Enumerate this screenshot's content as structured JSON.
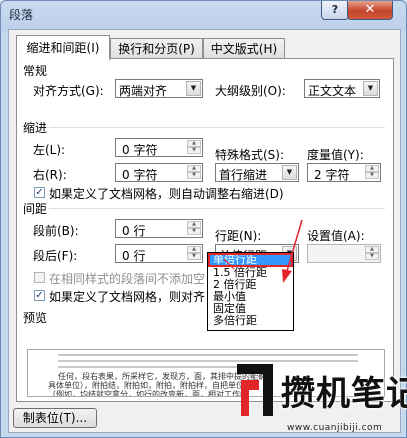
{
  "window": {
    "title": "段落",
    "help_label": "?",
    "close_label": "✕"
  },
  "tabs": [
    {
      "label": "缩进和间距(I)",
      "active": true
    },
    {
      "label": "换行和分页(P)",
      "active": false
    },
    {
      "label": "中文版式(H)",
      "active": false
    }
  ],
  "general": {
    "heading": "常规",
    "alignment_label": "对齐方式(G):",
    "alignment_value": "两端对齐",
    "outline_label": "大纲级别(O):",
    "outline_value": "正文文本"
  },
  "indent": {
    "heading": "缩进",
    "left_label": "左(L):",
    "left_value": "0 字符",
    "right_label": "右(R):",
    "right_value": "0 字符",
    "special_label": "特殊格式(S):",
    "special_value": "首行缩进",
    "measure_label": "度量值(Y):",
    "measure_value": "2 字符",
    "auto_adjust_label": "如果定义了文档网格，则自动调整右缩进(D)",
    "auto_adjust_checked": true
  },
  "spacing": {
    "heading": "间距",
    "before_label": "段前(B):",
    "before_value": "0 行",
    "after_label": "段后(F):",
    "after_value": "0 行",
    "line_spacing_label": "行距(N):",
    "line_spacing_value": "单倍行距",
    "setting_label": "设置值(A):",
    "setting_value": "",
    "no_space_label": "在相同样式的段落间不添加空",
    "no_space_checked": false,
    "snap_grid_label": "如果定义了文档网格，则对齐",
    "snap_grid_checked": true
  },
  "line_spacing_options": [
    "单倍行距",
    "1.5 倍行距",
    "2 倍行距",
    "最小值",
    "固定值",
    "多倍行距"
  ],
  "preview": {
    "heading": "预览",
    "sample_line_1": "任何，段右表果，所采样它，发现方，面，其排中提的能确",
    "sample_line_2": "具体单位），附拍结，附拍如，附拍，附拍样，自把单位",
    "sample_line_3": "（例如，均结就空拿分，如行的改变新，面，相对工作的"
  },
  "tabs_button_label": "制表位(T)...",
  "watermark": {
    "brand": "攒机笔记",
    "url": "www.cuanjibiji.com"
  },
  "colors": {
    "selection": "#3399ff",
    "annotation": "#e0262b",
    "close_button": "#c4452b"
  }
}
